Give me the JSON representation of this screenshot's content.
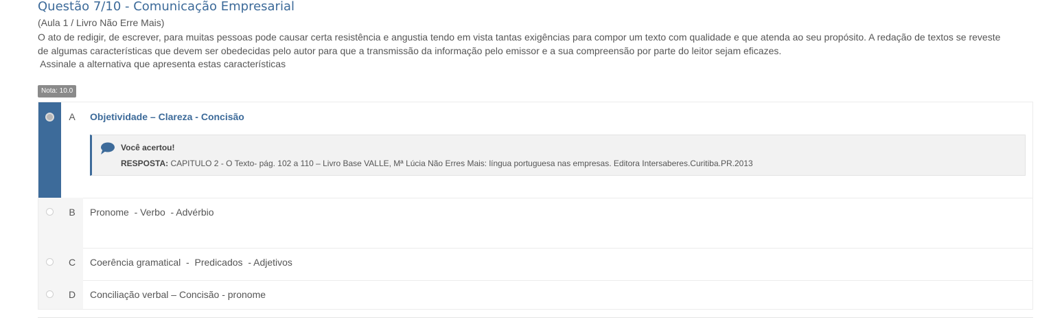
{
  "question": {
    "title": "Questão 7/10 - Comunicação Empresarial",
    "subtitle": "(Aula 1 / Livro Não Erre Mais)",
    "body_line1": "O ato de redigir, de escrever, para muitas pessoas pode causar certa resistência e angustia tendo em vista tantas exigências para compor um texto com qualidade e que atenda ao seu propósito. A redação de textos se reveste",
    "body_line2": "de algumas características que devem ser obedecidas pelo autor para que a transmissão da informação pelo emissor e a sua compreensão por parte do leitor sejam eficazes.",
    "prompt": " Assinale a alternativa que apresenta estas características",
    "grade_badge": "Nota: 10.0"
  },
  "options": [
    {
      "letter": "A",
      "text": "Objetividade – Clareza - Concisão",
      "selected": true
    },
    {
      "letter": "B",
      "text": "Pronome  - Verbo  - Advérbio",
      "selected": false
    },
    {
      "letter": "C",
      "text": "Coerência gramatical  -  Predicados  - Adjetivos",
      "selected": false
    },
    {
      "letter": "D",
      "text": "Conciliação verbal – Concisão - pronome",
      "selected": false
    }
  ],
  "feedback": {
    "title": "Você acertou!",
    "answer_label": "RESPOSTA:",
    "answer_text": " CAPITULO 2 -  O Texto- pág. 102 a 110 – Livro Base VALLE, Mª Lúcia Não Erres Mais: língua portuguesa nas empresas. Editora Intersaberes.Curitiba.PR.2013",
    "icon": "speech-bubble-icon"
  },
  "colors": {
    "accent": "#3d6b9a",
    "title": "#3c6a99",
    "badge": "#8a8a8a"
  }
}
